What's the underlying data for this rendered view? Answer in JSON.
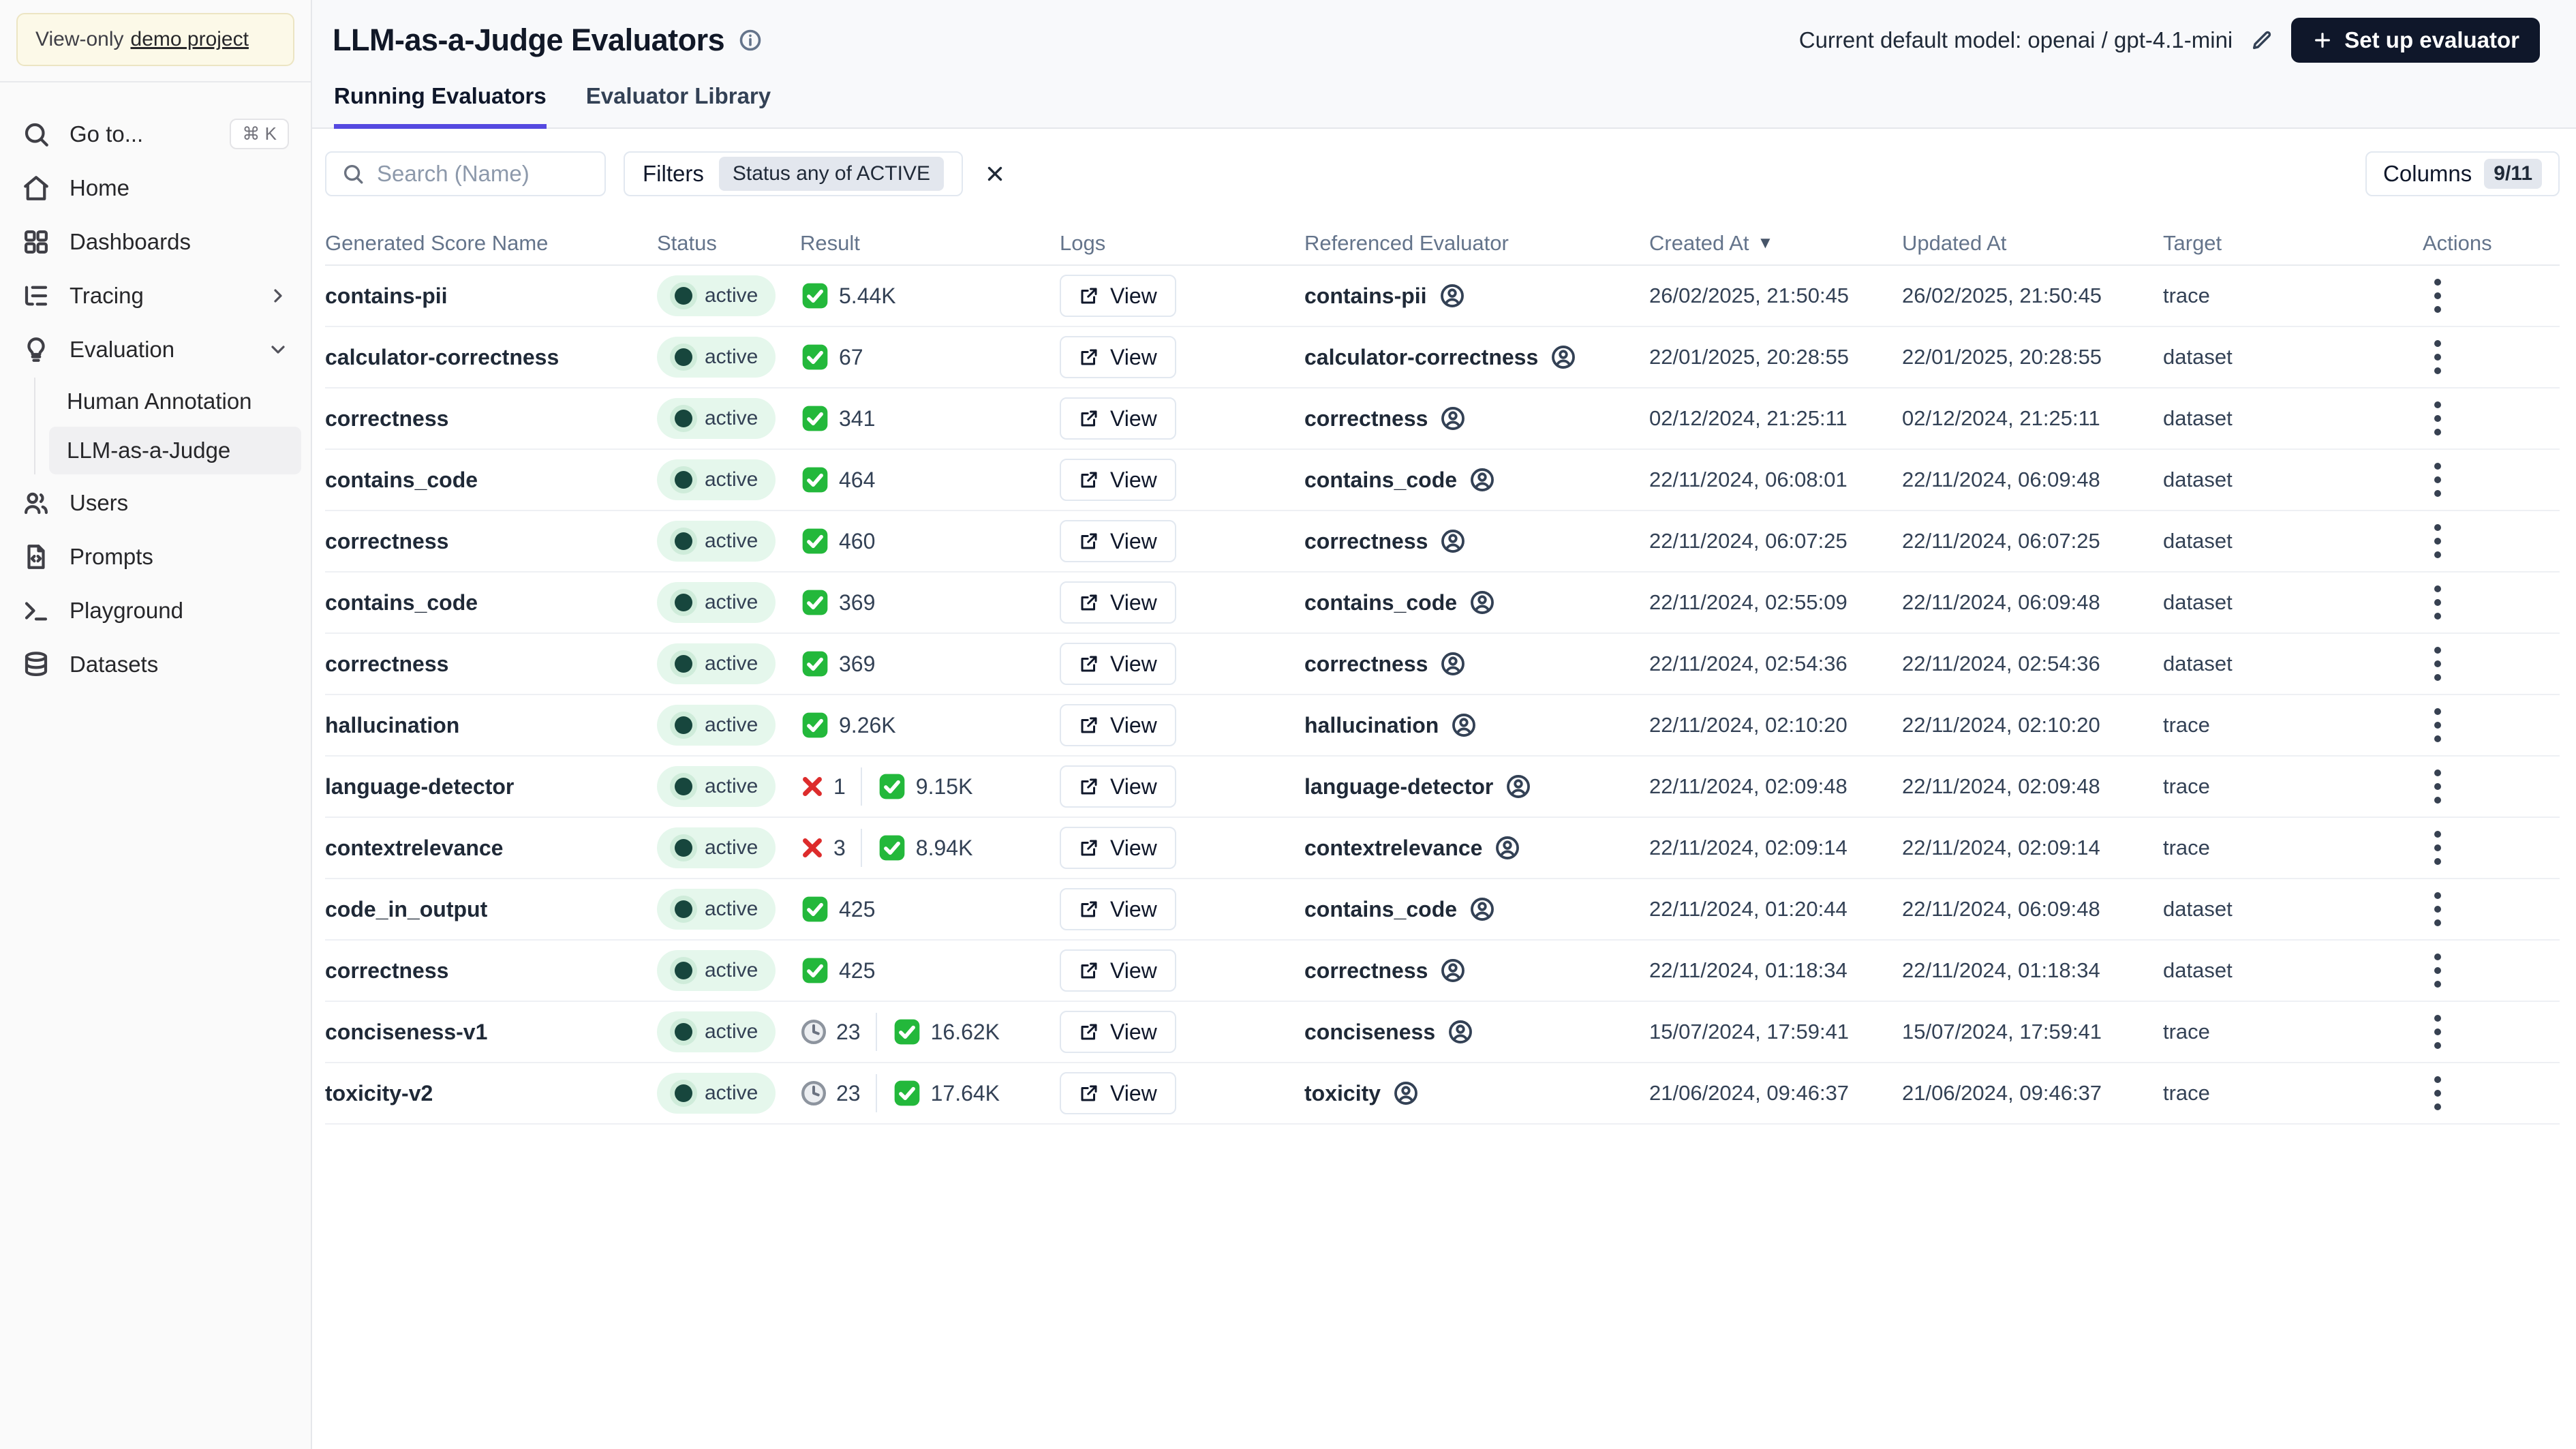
{
  "colors": {
    "accent_indigo": "#5549e0",
    "dark_button": "#0f172a",
    "success_green": "#23b83b",
    "error_red": "#dd2c2c",
    "pending_gray": "#9aa2ad",
    "active_badge_bg": "#e5f7ec",
    "active_dot": "#17463d",
    "band_bg": "#f8f9fb",
    "sidebar_bg": "#fafafa",
    "project_box_bg": "#fcf9e8"
  },
  "sidebar": {
    "project_notice": {
      "prefix": "View-only",
      "link": "demo project"
    },
    "goto": {
      "label": "Go to...",
      "shortcut": "⌘ K"
    },
    "items": {
      "home": "Home",
      "dashboards": "Dashboards",
      "tracing": "Tracing",
      "evaluation": "Evaluation",
      "users": "Users",
      "prompts": "Prompts",
      "playground": "Playground",
      "datasets": "Datasets"
    },
    "evaluation_children": {
      "human_annotation": "Human Annotation",
      "llm_judge": "LLM-as-a-Judge"
    },
    "selected_item": "LLM-as-a-Judge"
  },
  "header": {
    "title": "LLM-as-a-Judge Evaluators",
    "model_label": "Current default model: openai / gpt-4.1-mini",
    "setup_button": "Set up evaluator",
    "tabs": [
      {
        "label": "Running Evaluators",
        "active": true
      },
      {
        "label": "Evaluator Library",
        "active": false
      }
    ]
  },
  "toolbar": {
    "search_placeholder": "Search (Name)",
    "filters_label": "Filters",
    "filter_badge": "Status any of ACTIVE",
    "columns_label": "Columns",
    "columns_badge": "9/11"
  },
  "table": {
    "columns": [
      "Generated Score Name",
      "Status",
      "Result",
      "Logs",
      "Referenced Evaluator",
      "Created At",
      "Updated At",
      "Target",
      "Actions"
    ],
    "sorted_column": "Created At",
    "sort_direction": "desc",
    "view_label": "View",
    "rows": [
      {
        "name": "contains-pii",
        "status": "active",
        "result": {
          "error": null,
          "pending": null,
          "success": "5.44K"
        },
        "ref": "contains-pii",
        "created": "26/02/2025, 21:50:45",
        "updated": "26/02/2025, 21:50:45",
        "target": "trace"
      },
      {
        "name": "calculator-correctness",
        "status": "active",
        "result": {
          "error": null,
          "pending": null,
          "success": "67"
        },
        "ref": "calculator-correctness",
        "created": "22/01/2025, 20:28:55",
        "updated": "22/01/2025, 20:28:55",
        "target": "dataset"
      },
      {
        "name": "correctness",
        "status": "active",
        "result": {
          "error": null,
          "pending": null,
          "success": "341"
        },
        "ref": "correctness",
        "created": "02/12/2024, 21:25:11",
        "updated": "02/12/2024, 21:25:11",
        "target": "dataset"
      },
      {
        "name": "contains_code",
        "status": "active",
        "result": {
          "error": null,
          "pending": null,
          "success": "464"
        },
        "ref": "contains_code",
        "created": "22/11/2024, 06:08:01",
        "updated": "22/11/2024, 06:09:48",
        "target": "dataset"
      },
      {
        "name": "correctness",
        "status": "active",
        "result": {
          "error": null,
          "pending": null,
          "success": "460"
        },
        "ref": "correctness",
        "created": "22/11/2024, 06:07:25",
        "updated": "22/11/2024, 06:07:25",
        "target": "dataset"
      },
      {
        "name": "contains_code",
        "status": "active",
        "result": {
          "error": null,
          "pending": null,
          "success": "369"
        },
        "ref": "contains_code",
        "created": "22/11/2024, 02:55:09",
        "updated": "22/11/2024, 06:09:48",
        "target": "dataset"
      },
      {
        "name": "correctness",
        "status": "active",
        "result": {
          "error": null,
          "pending": null,
          "success": "369"
        },
        "ref": "correctness",
        "created": "22/11/2024, 02:54:36",
        "updated": "22/11/2024, 02:54:36",
        "target": "dataset"
      },
      {
        "name": "hallucination",
        "status": "active",
        "result": {
          "error": null,
          "pending": null,
          "success": "9.26K"
        },
        "ref": "hallucination",
        "created": "22/11/2024, 02:10:20",
        "updated": "22/11/2024, 02:10:20",
        "target": "trace"
      },
      {
        "name": "language-detector",
        "status": "active",
        "result": {
          "error": "1",
          "pending": null,
          "success": "9.15K"
        },
        "ref": "language-detector",
        "created": "22/11/2024, 02:09:48",
        "updated": "22/11/2024, 02:09:48",
        "target": "trace"
      },
      {
        "name": "contextrelevance",
        "status": "active",
        "result": {
          "error": "3",
          "pending": null,
          "success": "8.94K"
        },
        "ref": "contextrelevance",
        "created": "22/11/2024, 02:09:14",
        "updated": "22/11/2024, 02:09:14",
        "target": "trace"
      },
      {
        "name": "code_in_output",
        "status": "active",
        "result": {
          "error": null,
          "pending": null,
          "success": "425"
        },
        "ref": "contains_code",
        "created": "22/11/2024, 01:20:44",
        "updated": "22/11/2024, 06:09:48",
        "target": "dataset"
      },
      {
        "name": "correctness",
        "status": "active",
        "result": {
          "error": null,
          "pending": null,
          "success": "425"
        },
        "ref": "correctness",
        "created": "22/11/2024, 01:18:34",
        "updated": "22/11/2024, 01:18:34",
        "target": "dataset"
      },
      {
        "name": "conciseness-v1",
        "status": "active",
        "result": {
          "error": null,
          "pending": "23",
          "success": "16.62K"
        },
        "ref": "conciseness",
        "created": "15/07/2024, 17:59:41",
        "updated": "15/07/2024, 17:59:41",
        "target": "trace"
      },
      {
        "name": "toxicity-v2",
        "status": "active",
        "result": {
          "error": null,
          "pending": "23",
          "success": "17.64K"
        },
        "ref": "toxicity",
        "created": "21/06/2024, 09:46:37",
        "updated": "21/06/2024, 09:46:37",
        "target": "trace"
      }
    ]
  }
}
